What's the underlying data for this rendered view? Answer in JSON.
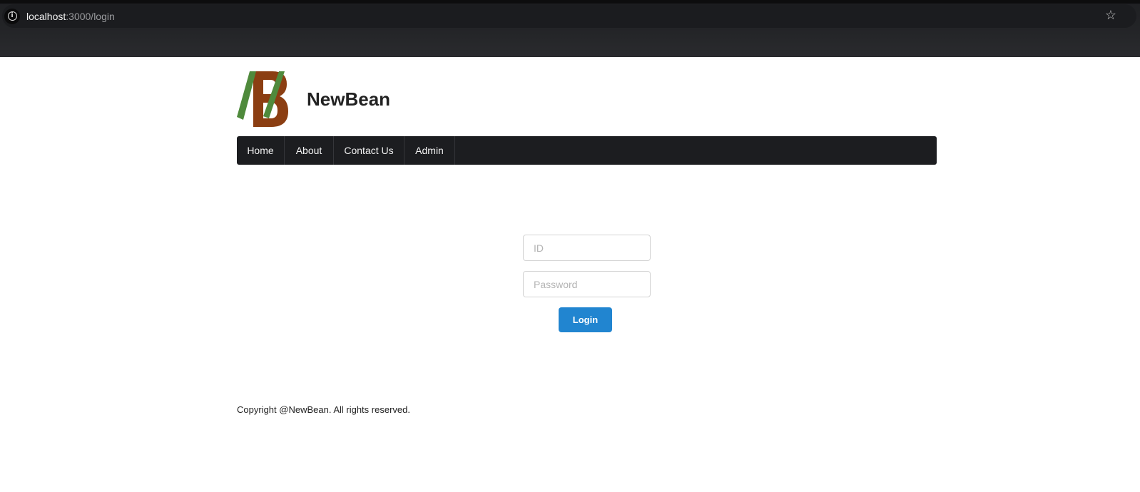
{
  "browser": {
    "url_host": "localhost",
    "url_path": ":3000/login",
    "info_icon": "info-icon",
    "bookmark_icon": "star-icon"
  },
  "site": {
    "title": "NewBean",
    "logo": "newbean-logo",
    "logo_colors": {
      "green": "#4f8a3c",
      "brown": "#8b3e12"
    }
  },
  "nav": {
    "items": [
      {
        "label": "Home"
      },
      {
        "label": "About"
      },
      {
        "label": "Contact Us"
      },
      {
        "label": "Admin"
      }
    ]
  },
  "login": {
    "id_placeholder": "ID",
    "id_value": "",
    "password_placeholder": "Password",
    "password_value": "",
    "button_label": "Login",
    "button_color": "#2185d0"
  },
  "footer": {
    "text": "Copyright @NewBean. All rights reserved."
  }
}
